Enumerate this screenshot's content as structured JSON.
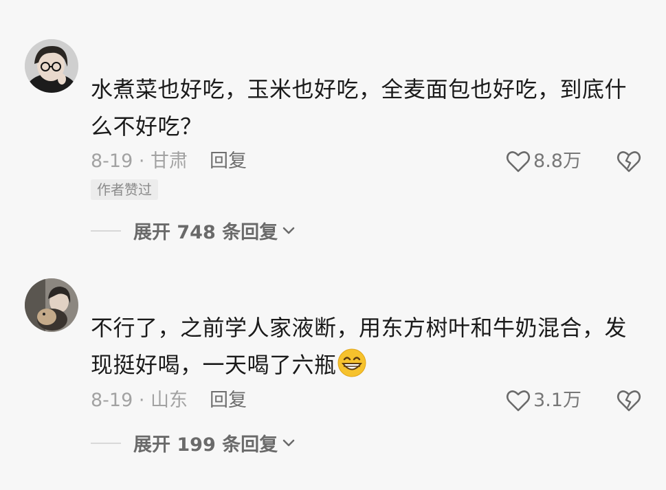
{
  "comments": [
    {
      "text": "水煮菜也好吃，玉米也好吃，全麦面包也好吃，到底什么不好吃？",
      "date_location": "8-19 · 甘肃",
      "reply_label": "回复",
      "likes": "8.8万",
      "badge": "作者赞过",
      "expand_label": "展开 748 条回复"
    },
    {
      "text": "不行了，之前学人家液断，用东方树叶和牛奶混合，发现挺好喝，一天喝了六瓶",
      "date_location": "8-19 · 山东",
      "reply_label": "回复",
      "likes": "3.1万",
      "expand_label": "展开 199 条回复"
    }
  ]
}
